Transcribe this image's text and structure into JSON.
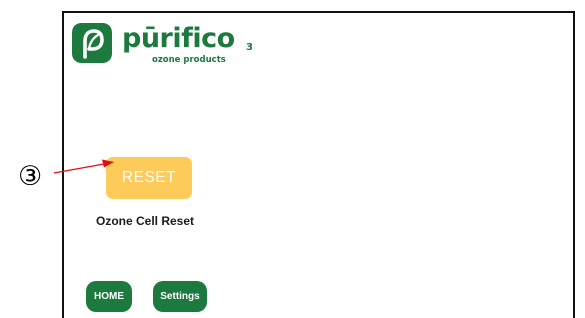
{
  "colors": {
    "brand_green": "#1d7a3e",
    "reset_yellow": "#fccb5a",
    "annotation_red": "#e01010"
  },
  "logo": {
    "icon": "purifico-leaf-icon",
    "brand_name": "pūrifico",
    "sub_text": "ozone products",
    "brand_mark": "3"
  },
  "main": {
    "reset_button_label": "RESET",
    "reset_caption": "Ozone Cell Reset"
  },
  "nav": {
    "home_label": "HOME",
    "settings_label": "Settings"
  },
  "annotation": {
    "callout_number": "③"
  }
}
